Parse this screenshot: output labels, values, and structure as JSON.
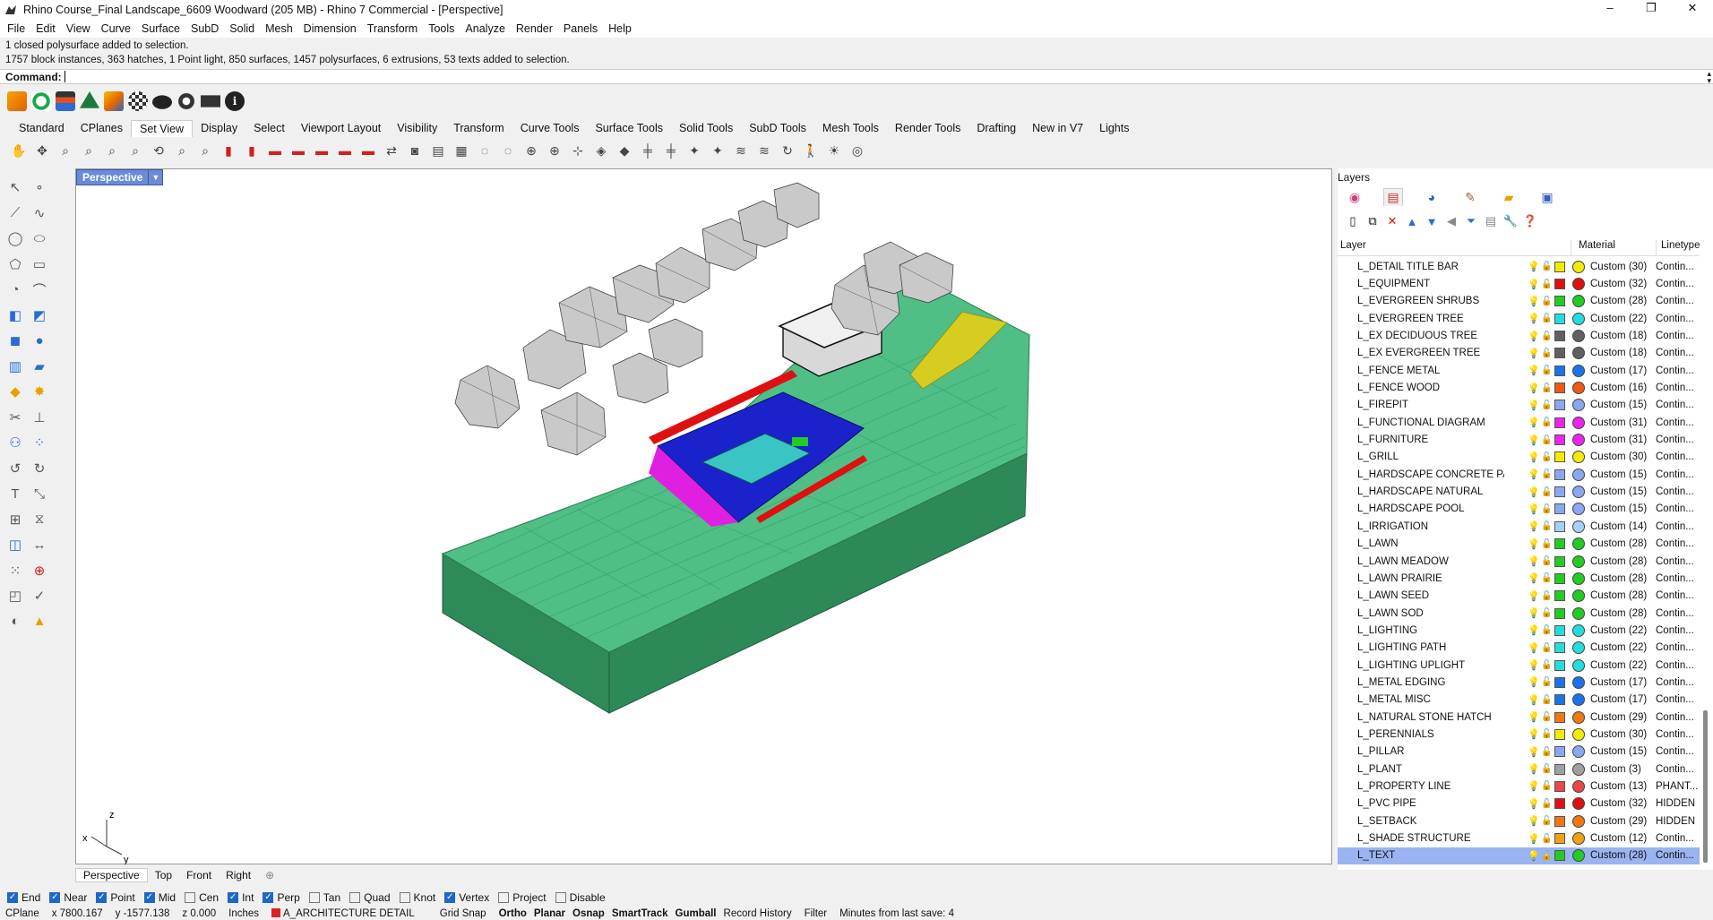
{
  "window": {
    "title": "Rhino Course_Final Landscape_6609 Woodward (205 MB) - Rhino 7 Commercial - [Perspective]",
    "controls": [
      "–",
      "❐",
      "✕"
    ]
  },
  "menu": [
    "File",
    "Edit",
    "View",
    "Curve",
    "Surface",
    "SubD",
    "Solid",
    "Mesh",
    "Dimension",
    "Transform",
    "Tools",
    "Analyze",
    "Render",
    "Panels",
    "Help"
  ],
  "command_history": [
    "1 closed polysurface added to selection.",
    "1757 block instances, 363 hatches, 1 Point light, 850 surfaces, 1457 polysurfaces, 6 extrusions, 53 texts added to selection."
  ],
  "command_label": "Command:",
  "toolbar_tabs": [
    "Standard",
    "CPlanes",
    "Set View",
    "Display",
    "Select",
    "Viewport Layout",
    "Visibility",
    "Transform",
    "Curve Tools",
    "Surface Tools",
    "Solid Tools",
    "SubD Tools",
    "Mesh Tools",
    "Render Tools",
    "Drafting",
    "New in V7",
    "Lights"
  ],
  "active_toolbar_tab": "Set View",
  "viewport": {
    "label": "Perspective",
    "axes": {
      "x": "x",
      "y": "y",
      "z": "z"
    }
  },
  "viewport_tabs": [
    "Perspective",
    "Top",
    "Front",
    "Right"
  ],
  "layers_panel": {
    "title": "Layers",
    "columns": {
      "layer": "Layer",
      "material": "Material",
      "linetype": "Linetype"
    },
    "rows": [
      {
        "name": "L_DETAIL TITLE BAR",
        "color": "#f4ec00",
        "material": "Custom (30)",
        "linetype": "Contin..."
      },
      {
        "name": "L_EQUIPMENT",
        "color": "#e01010",
        "material": "Custom (32)",
        "linetype": "Contin..."
      },
      {
        "name": "L_EVERGREEN SHRUBS",
        "color": "#22cc22",
        "material": "Custom (28)",
        "linetype": "Contin..."
      },
      {
        "name": "L_EVERGREEN TREE",
        "color": "#22dddd",
        "material": "Custom (22)",
        "linetype": "Contin..."
      },
      {
        "name": "L_EX DECIDUOUS TREE",
        "color": "#606060",
        "material": "Custom (18)",
        "linetype": "Contin..."
      },
      {
        "name": "L_EX EVERGREEN TREE",
        "color": "#606060",
        "material": "Custom (18)",
        "linetype": "Contin..."
      },
      {
        "name": "L_FENCE METAL",
        "color": "#1a73e8",
        "material": "Custom (17)",
        "linetype": "Contin..."
      },
      {
        "name": "L_FENCE WOOD",
        "color": "#f05a10",
        "material": "Custom (16)",
        "linetype": "Contin..."
      },
      {
        "name": "L_FIREPIT",
        "color": "#8aa8f0",
        "material": "Custom (15)",
        "linetype": "Contin..."
      },
      {
        "name": "L_FUNCTIONAL DIAGRAM",
        "color": "#ee22ee",
        "material": "Custom (31)",
        "linetype": "Contin..."
      },
      {
        "name": "L_FURNITURE",
        "color": "#ee22ee",
        "material": "Custom (31)",
        "linetype": "Contin..."
      },
      {
        "name": "L_GRILL",
        "color": "#f4ec00",
        "material": "Custom (30)",
        "linetype": "Contin..."
      },
      {
        "name": "L_HARDSCAPE CONCRETE PA...",
        "color": "#8aa8f0",
        "material": "Custom (15)",
        "linetype": "Contin..."
      },
      {
        "name": "L_HARDSCAPE NATURAL",
        "color": "#8aa8f0",
        "material": "Custom (15)",
        "linetype": "Contin..."
      },
      {
        "name": "L_HARDSCAPE POOL",
        "color": "#8aa8f0",
        "material": "Custom (15)",
        "linetype": "Contin..."
      },
      {
        "name": "L_IRRIGATION",
        "color": "#a8d0f8",
        "material": "Custom (14)",
        "linetype": "Contin..."
      },
      {
        "name": "L_LAWN",
        "color": "#22cc22",
        "material": "Custom (28)",
        "linetype": "Contin..."
      },
      {
        "name": "L_LAWN MEADOW",
        "color": "#22cc22",
        "material": "Custom (28)",
        "linetype": "Contin..."
      },
      {
        "name": "L_LAWN PRAIRIE",
        "color": "#22cc22",
        "material": "Custom (28)",
        "linetype": "Contin..."
      },
      {
        "name": "L_LAWN SEED",
        "color": "#22cc22",
        "material": "Custom (28)",
        "linetype": "Contin..."
      },
      {
        "name": "L_LAWN SOD",
        "color": "#22cc22",
        "material": "Custom (28)",
        "linetype": "Contin..."
      },
      {
        "name": "L_LIGHTING",
        "color": "#22dddd",
        "material": "Custom (22)",
        "linetype": "Contin..."
      },
      {
        "name": "L_LIGHTING PATH",
        "color": "#22dddd",
        "material": "Custom (22)",
        "linetype": "Contin..."
      },
      {
        "name": "L_LIGHTING UPLIGHT",
        "color": "#22dddd",
        "material": "Custom (22)",
        "linetype": "Contin..."
      },
      {
        "name": "L_METAL EDGING",
        "color": "#1a73e8",
        "material": "Custom (17)",
        "linetype": "Contin..."
      },
      {
        "name": "L_METAL MISC",
        "color": "#1a73e8",
        "material": "Custom (17)",
        "linetype": "Contin..."
      },
      {
        "name": "L_NATURAL STONE HATCH",
        "color": "#f07810",
        "material": "Custom (29)",
        "linetype": "Contin..."
      },
      {
        "name": "L_PERENNIALS",
        "color": "#f4ec00",
        "material": "Custom (30)",
        "linetype": "Contin..."
      },
      {
        "name": "L_PILLAR",
        "color": "#8aa8f0",
        "material": "Custom (15)",
        "linetype": "Contin..."
      },
      {
        "name": "L_PLANT",
        "color": "#a0a0a0",
        "material": "Custom (3)",
        "linetype": "Contin..."
      },
      {
        "name": "L_PROPERTY LINE",
        "color": "#e84848",
        "material": "Custom (13)",
        "linetype": "PHANT..."
      },
      {
        "name": "L_PVC PIPE",
        "color": "#e01010",
        "material": "Custom (32)",
        "linetype": "HIDDEN"
      },
      {
        "name": "L_SETBACK",
        "color": "#f07810",
        "material": "Custom (29)",
        "linetype": "HIDDEN"
      },
      {
        "name": "L_SHADE STRUCTURE",
        "color": "#f0a010",
        "material": "Custom (12)",
        "linetype": "Contin..."
      },
      {
        "name": "L_TEXT",
        "color": "#22cc22",
        "material": "Custom (28)",
        "linetype": "Contin...",
        "selected": true
      }
    ]
  },
  "osnaps": [
    {
      "label": "End",
      "checked": true
    },
    {
      "label": "Near",
      "checked": true
    },
    {
      "label": "Point",
      "checked": true
    },
    {
      "label": "Mid",
      "checked": true
    },
    {
      "label": "Cen",
      "checked": false
    },
    {
      "label": "Int",
      "checked": true
    },
    {
      "label": "Perp",
      "checked": true
    },
    {
      "label": "Tan",
      "checked": false
    },
    {
      "label": "Quad",
      "checked": false
    },
    {
      "label": "Knot",
      "checked": false
    },
    {
      "label": "Vertex",
      "checked": true
    },
    {
      "label": "Project",
      "checked": false
    },
    {
      "label": "Disable",
      "checked": false
    }
  ],
  "status": {
    "cplane": "CPlane",
    "x": "x 7800.167",
    "y": "y -1577.138",
    "z": "z 0.000",
    "units": "Inches",
    "layer": "A_ARCHITECTURE DETAIL",
    "grid_snap": "Grid Snap",
    "ortho": "Ortho",
    "planar": "Planar",
    "osnap": "Osnap",
    "smarttrack": "SmartTrack",
    "gumball": "Gumball",
    "record_history": "Record History",
    "filter": "Filter",
    "last_save": "Minutes from last save: 4"
  }
}
